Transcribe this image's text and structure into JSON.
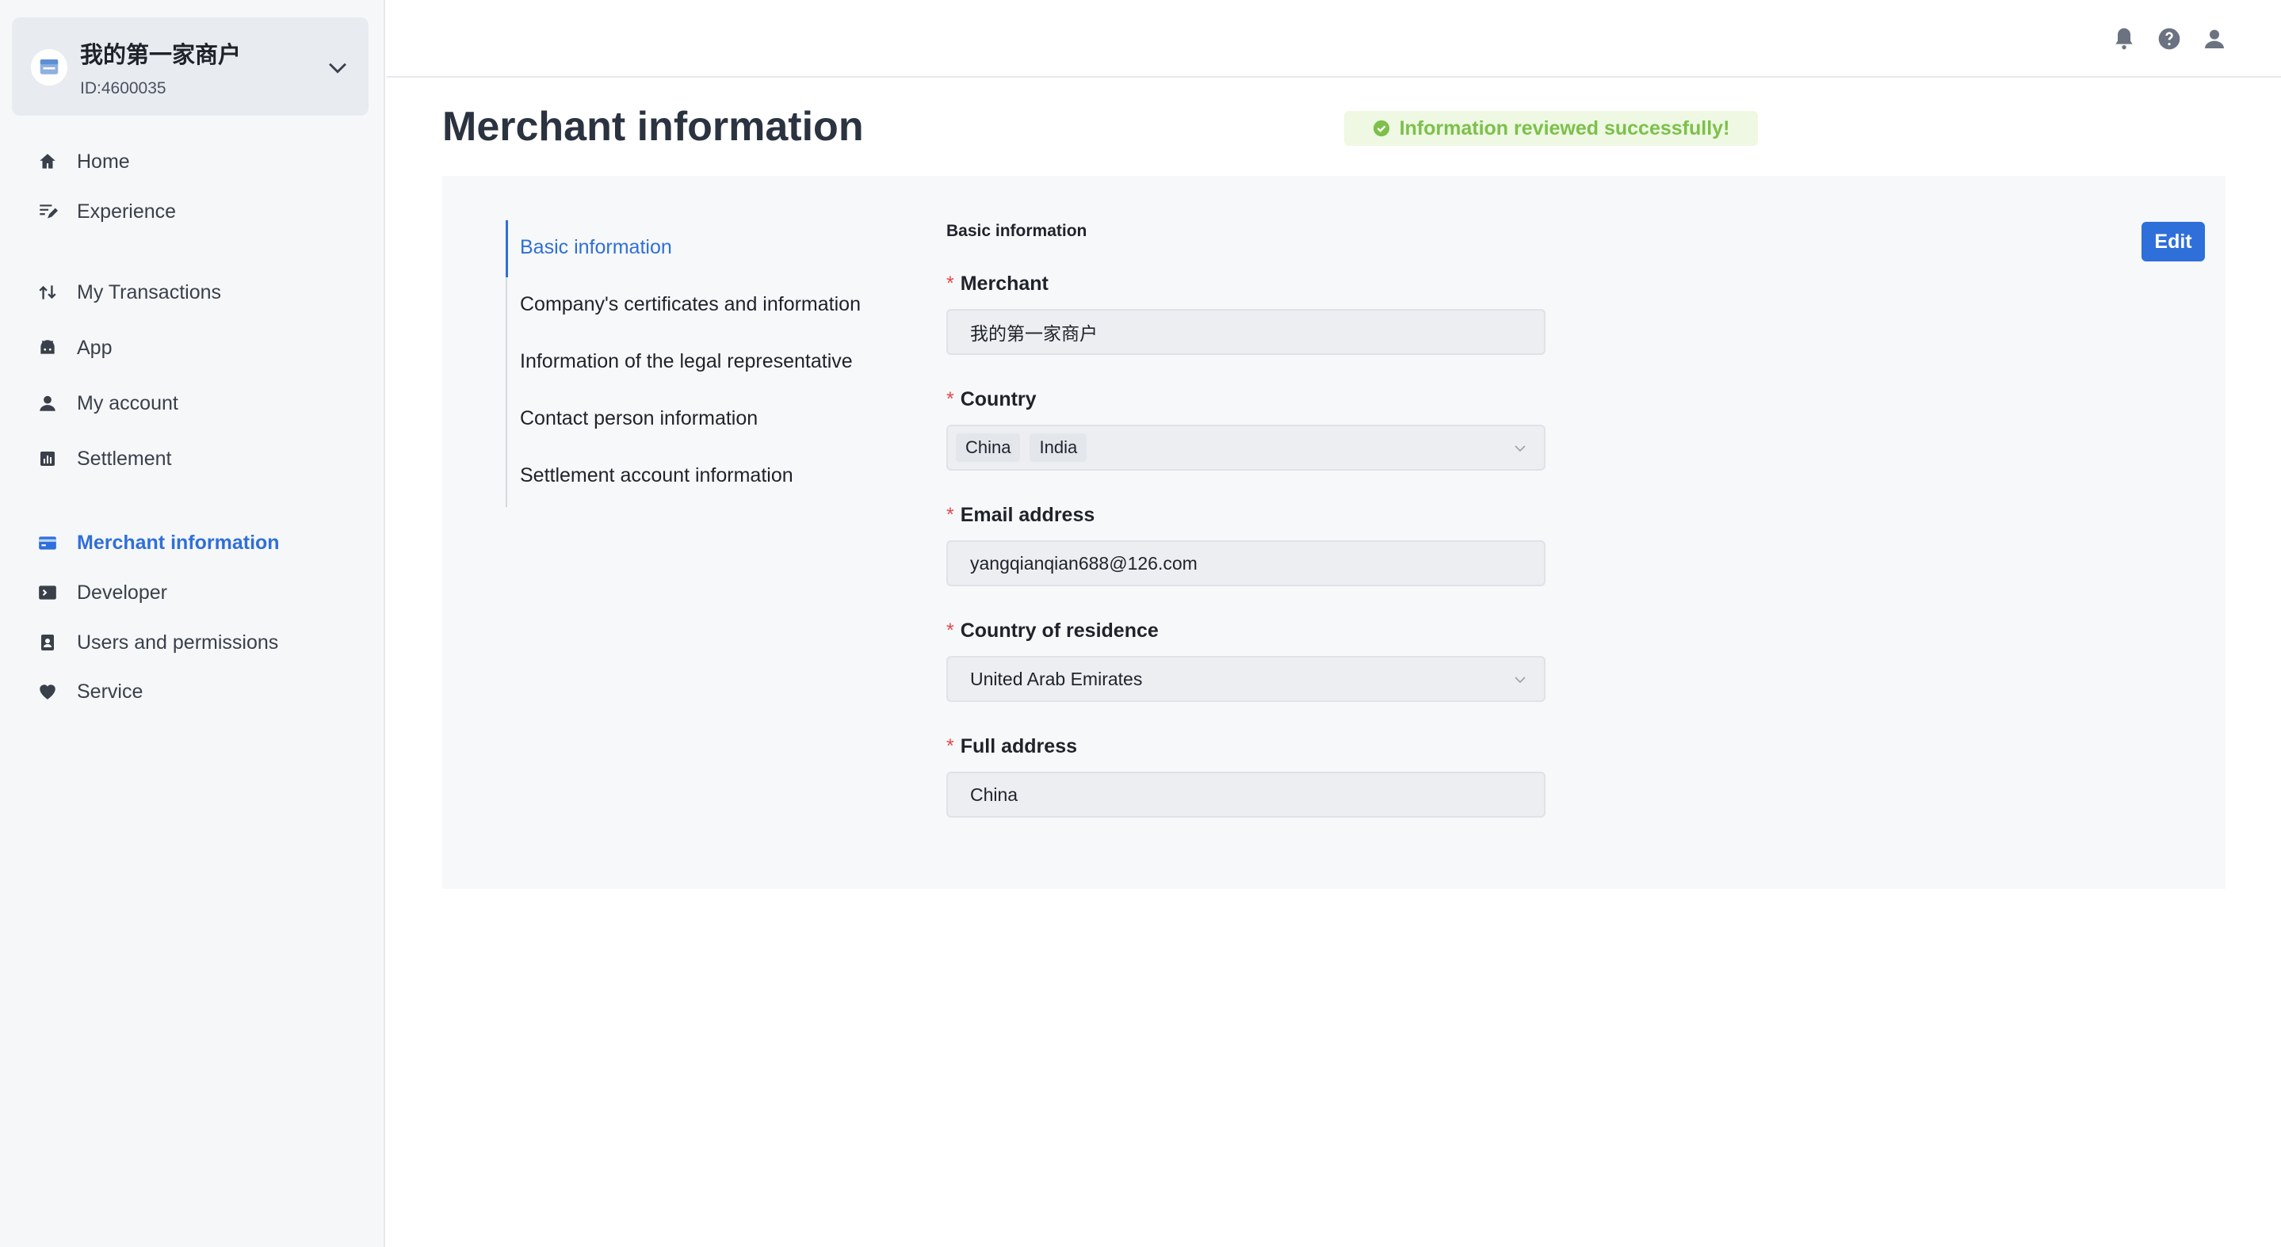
{
  "merchant_switch": {
    "name": "我的第一家商户",
    "id_label": "ID:4600035"
  },
  "sidebar": {
    "items": [
      {
        "label": "Home",
        "icon": "home-icon"
      },
      {
        "label": "Experience",
        "icon": "experience-icon"
      },
      {
        "label": "My Transactions",
        "icon": "transactions-icon"
      },
      {
        "label": "App",
        "icon": "android-icon"
      },
      {
        "label": "My account",
        "icon": "user-icon"
      },
      {
        "label": "Settlement",
        "icon": "bar-chart-icon"
      },
      {
        "label": "Merchant information",
        "icon": "card-icon",
        "active": true
      },
      {
        "label": "Developer",
        "icon": "terminal-icon"
      },
      {
        "label": "Users and permissions",
        "icon": "contacts-icon"
      },
      {
        "label": "Service",
        "icon": "heart-icon"
      }
    ]
  },
  "header": {
    "icons": [
      "bell-icon",
      "help-icon",
      "user-icon"
    ]
  },
  "page": {
    "title": "Merchant information",
    "status": "Information reviewed successfully!"
  },
  "sections": [
    "Basic information",
    "Company's certificates and information",
    "Information of the legal representative",
    "Contact person information",
    "Settlement account information"
  ],
  "form": {
    "heading": "Basic information",
    "edit_label": "Edit",
    "merchant": {
      "label": "Merchant",
      "value": "我的第一家商户"
    },
    "country": {
      "label": "Country",
      "tags": [
        "China",
        "India"
      ]
    },
    "email": {
      "label": "Email address",
      "value": "yangqianqian688@126.com"
    },
    "residence": {
      "label": "Country of residence",
      "value": "United Arab Emirates"
    },
    "address": {
      "label": "Full address",
      "value": "China"
    },
    "required_mark": "*"
  },
  "colors": {
    "accent": "#2f6fd9",
    "success": "#7cc04a",
    "required": "#e5484d"
  }
}
